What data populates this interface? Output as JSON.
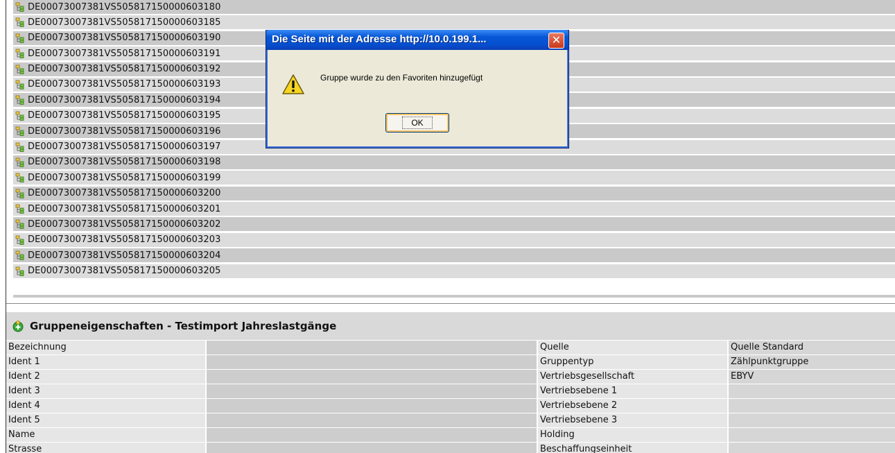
{
  "tree_items": [
    "DE00073007381VS505817150000603180",
    "DE00073007381VS505817150000603185",
    "DE00073007381VS505817150000603190",
    "DE00073007381VS505817150000603191",
    "DE00073007381VS505817150000603192",
    "DE00073007381VS505817150000603193",
    "DE00073007381VS505817150000603194",
    "DE00073007381VS505817150000603195",
    "DE00073007381VS505817150000603196",
    "DE00073007381VS505817150000603197",
    "DE00073007381VS505817150000603198",
    "DE00073007381VS505817150000603199",
    "DE00073007381VS505817150000603200",
    "DE00073007381VS505817150000603201",
    "DE00073007381VS505817150000603202",
    "DE00073007381VS505817150000603203",
    "DE00073007381VS505817150000603204",
    "DE00073007381VS505817150000603205"
  ],
  "properties": {
    "title": "Gruppeneigenschaften - Testimport Jahreslastgänge",
    "rows": [
      {
        "label": "Bezeichnung",
        "value": "",
        "label2": "Quelle",
        "value2": "Quelle Standard"
      },
      {
        "label": "Ident 1",
        "value": "",
        "label2": "Gruppentyp",
        "value2": "Zählpunktgruppe"
      },
      {
        "label": "Ident 2",
        "value": "",
        "label2": "Vertriebsgesellschaft",
        "value2": "EBYV"
      },
      {
        "label": "Ident 3",
        "value": "",
        "label2": "Vertriebsebene 1",
        "value2": ""
      },
      {
        "label": "Ident 4",
        "value": "",
        "label2": "Vertriebsebene 2",
        "value2": ""
      },
      {
        "label": "Ident 5",
        "value": "",
        "label2": "Vertriebsebene 3",
        "value2": ""
      },
      {
        "label": "Name",
        "value": "",
        "label2": "Holding",
        "value2": ""
      },
      {
        "label": "Strasse",
        "value": "",
        "label2": "Beschaffungseinheit",
        "value2": ""
      }
    ]
  },
  "dialog": {
    "title": "Die Seite mit der Adresse http://10.0.199.1...",
    "close_label": "✕",
    "message": "Gruppe wurde zu den Favoriten hinzugefügt",
    "ok_label": "OK"
  },
  "colors": {
    "titlebar": "#0757d6",
    "dialog_bg": "#ece9d8",
    "row_dark": "#c9c9c9",
    "row_light": "#dcdcdc"
  }
}
